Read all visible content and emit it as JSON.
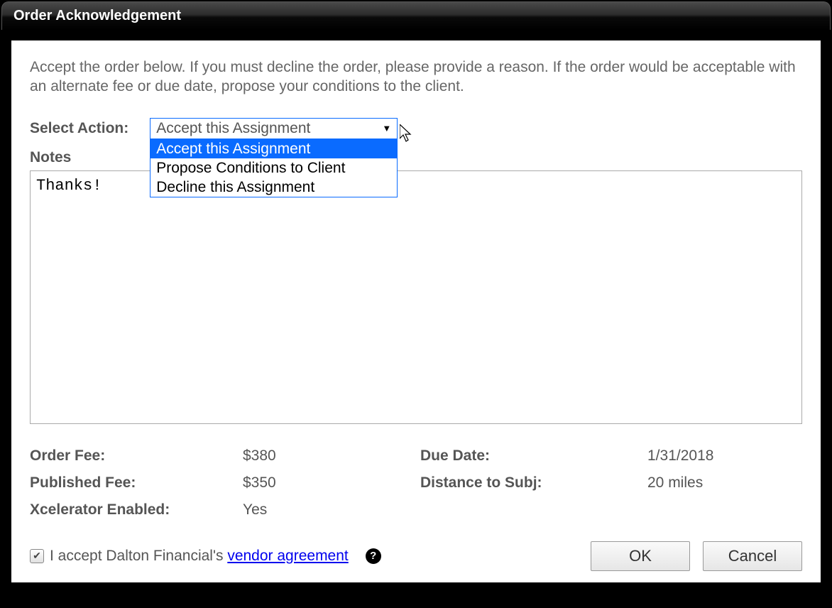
{
  "title": "Order Acknowledgement",
  "intro": "Accept the order below. If you must decline the order, please provide a reason. If the order would be acceptable with an alternate fee or due date, propose your conditions to the client.",
  "action": {
    "label": "Select Action:",
    "selected": "Accept this Assignment",
    "options": [
      "Accept this Assignment",
      "Propose Conditions to Client",
      "Decline this Assignment"
    ]
  },
  "notes": {
    "label": "Notes",
    "value": "Thanks!"
  },
  "details": {
    "order_fee_label": "Order Fee:",
    "order_fee_value": "$380",
    "due_date_label": "Due Date:",
    "due_date_value": "1/31/2018",
    "published_fee_label": "Published Fee:",
    "published_fee_value": "$350",
    "distance_label": "Distance to Subj:",
    "distance_value": "20 miles",
    "xcel_label": "Xcelerator Enabled:",
    "xcel_value": "Yes"
  },
  "accept": {
    "prefix": "I accept Dalton Financial's ",
    "link": "vendor agreement",
    "checked": true
  },
  "buttons": {
    "ok": "OK",
    "cancel": "Cancel"
  }
}
